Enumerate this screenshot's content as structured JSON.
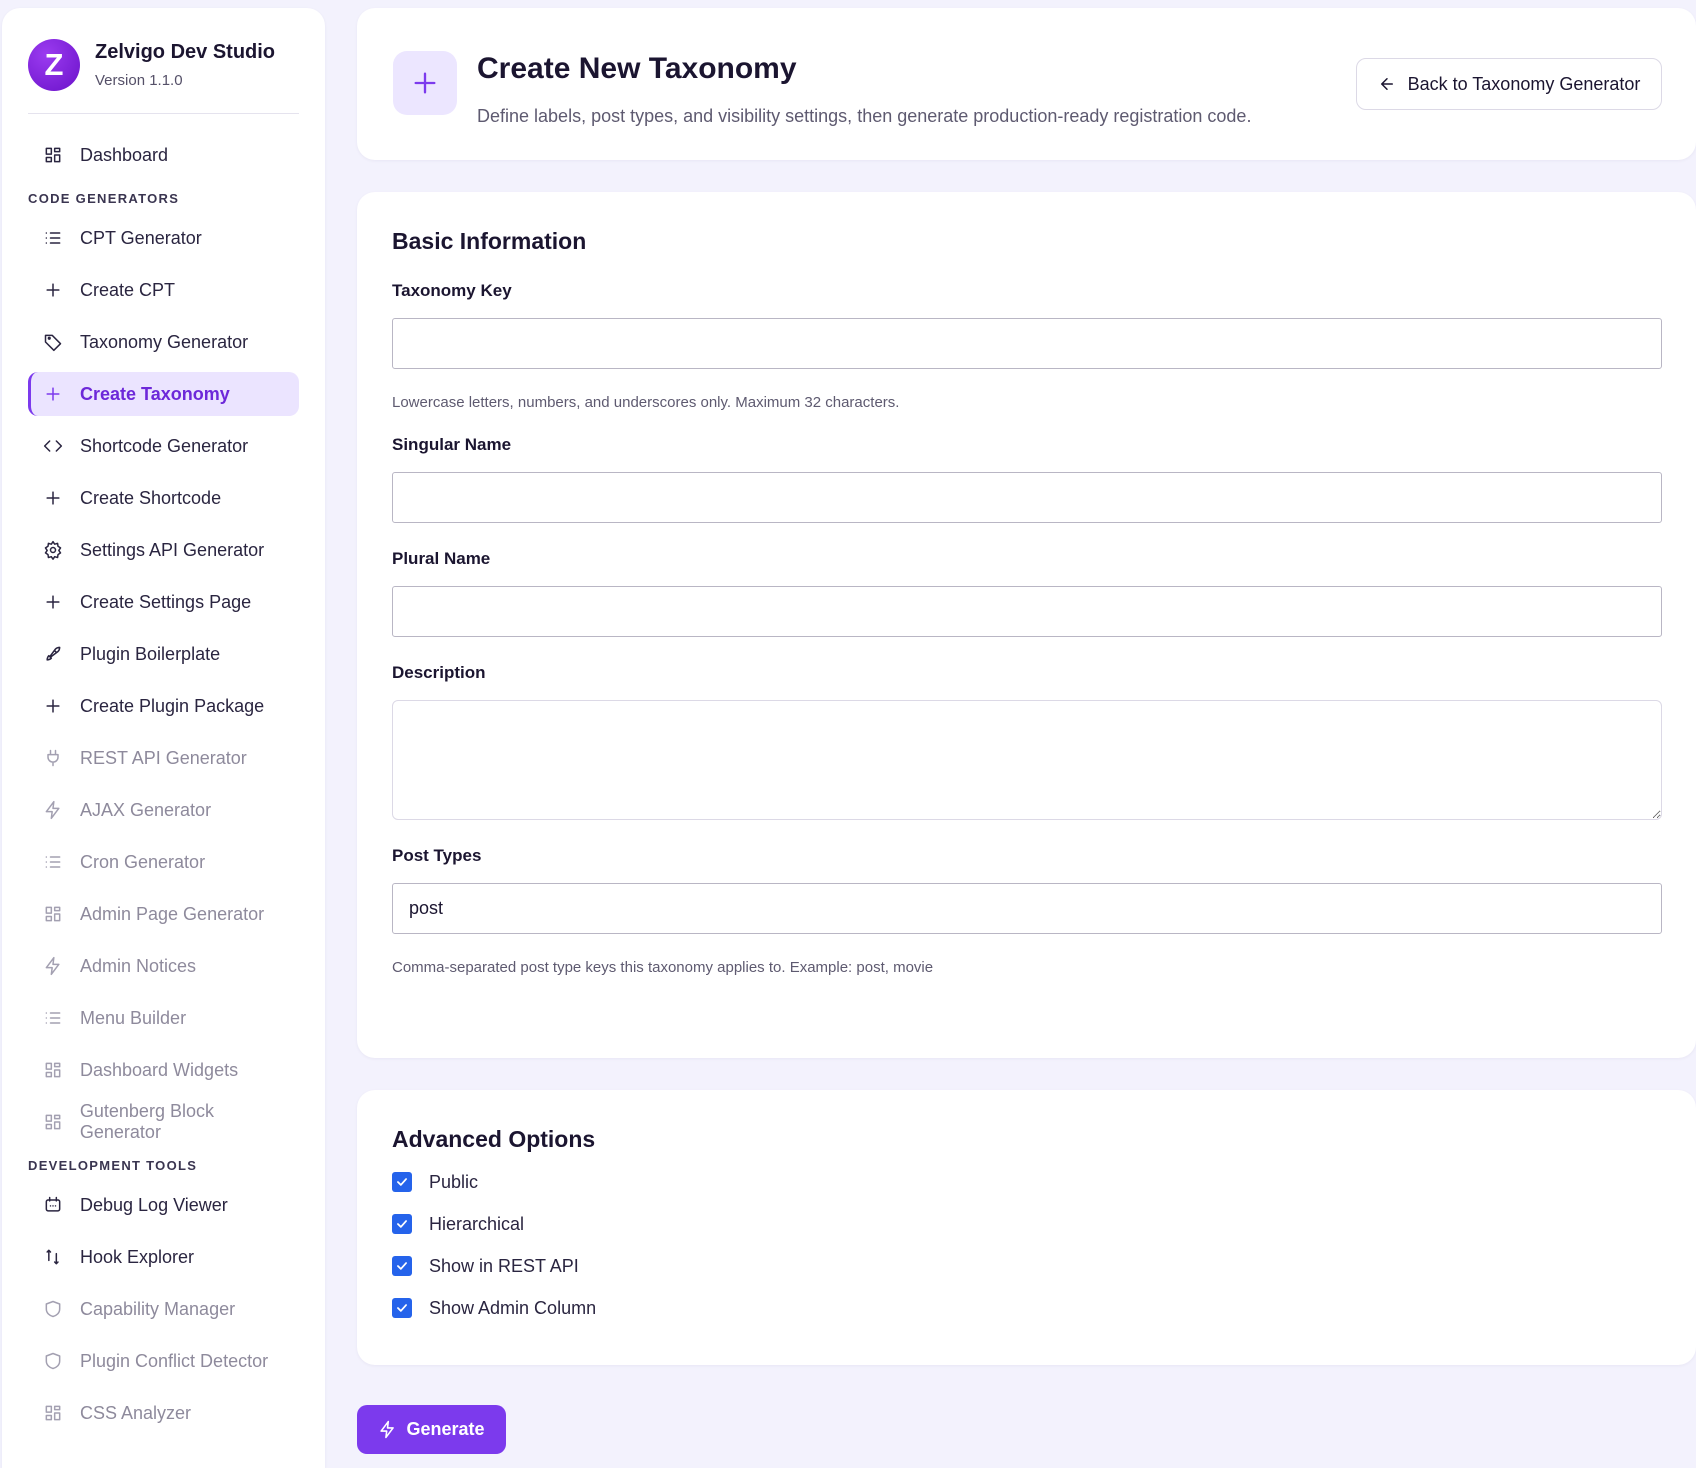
{
  "brand": {
    "logo_letter": "Z",
    "name": "Zelvigo Dev Studio",
    "version": "Version 1.1.0"
  },
  "sidebar": {
    "top_items": [
      {
        "label": "Dashboard",
        "icon": "dashboard-icon"
      }
    ],
    "sections": [
      {
        "title": "CODE GENERATORS",
        "items": [
          {
            "label": "CPT Generator",
            "icon": "list-icon",
            "state": "normal"
          },
          {
            "label": "Create CPT",
            "icon": "plus-icon",
            "state": "normal"
          },
          {
            "label": "Taxonomy Generator",
            "icon": "tag-icon",
            "state": "normal"
          },
          {
            "label": "Create Taxonomy",
            "icon": "plus-icon",
            "state": "active"
          },
          {
            "label": "Shortcode Generator",
            "icon": "code-icon",
            "state": "normal"
          },
          {
            "label": "Create Shortcode",
            "icon": "plus-icon",
            "state": "normal"
          },
          {
            "label": "Settings API Generator",
            "icon": "gear-icon",
            "state": "normal"
          },
          {
            "label": "Create Settings Page",
            "icon": "plus-icon",
            "state": "normal"
          },
          {
            "label": "Plugin Boilerplate",
            "icon": "rocket-icon",
            "state": "normal"
          },
          {
            "label": "Create Plugin Package",
            "icon": "plus-icon",
            "state": "normal"
          },
          {
            "label": "REST API Generator",
            "icon": "plug-icon",
            "state": "disabled"
          },
          {
            "label": "AJAX Generator",
            "icon": "bolt-icon",
            "state": "disabled"
          },
          {
            "label": "Cron Generator",
            "icon": "list-icon",
            "state": "disabled"
          },
          {
            "label": "Admin Page Generator",
            "icon": "dashboard-icon",
            "state": "disabled"
          },
          {
            "label": "Admin Notices",
            "icon": "bolt-icon",
            "state": "disabled"
          },
          {
            "label": "Menu Builder",
            "icon": "list-icon",
            "state": "disabled"
          },
          {
            "label": "Dashboard Widgets",
            "icon": "dashboard-icon",
            "state": "disabled"
          },
          {
            "label": "Gutenberg Block Generator",
            "icon": "dashboard-icon",
            "state": "disabled"
          }
        ]
      },
      {
        "title": "DEVELOPMENT TOOLS",
        "items": [
          {
            "label": "Debug Log Viewer",
            "icon": "bug-icon",
            "state": "normal"
          },
          {
            "label": "Hook Explorer",
            "icon": "hook-icon",
            "state": "normal"
          },
          {
            "label": "Capability Manager",
            "icon": "shield-icon",
            "state": "disabled"
          },
          {
            "label": "Plugin Conflict Detector",
            "icon": "shield-icon",
            "state": "disabled"
          },
          {
            "label": "CSS Analyzer",
            "icon": "dashboard-icon",
            "state": "disabled"
          }
        ]
      }
    ]
  },
  "header": {
    "title": "Create New Taxonomy",
    "subtitle": "Define labels, post types, and visibility settings, then generate production-ready registration code.",
    "back_label": "Back to Taxonomy Generator"
  },
  "basic": {
    "title": "Basic Information",
    "taxonomy_key": {
      "label": "Taxonomy Key",
      "value": "",
      "help": "Lowercase letters, numbers, and underscores only. Maximum 32 characters."
    },
    "singular_name": {
      "label": "Singular Name",
      "value": ""
    },
    "plural_name": {
      "label": "Plural Name",
      "value": ""
    },
    "description": {
      "label": "Description",
      "value": ""
    },
    "post_types": {
      "label": "Post Types",
      "value": "post",
      "help": "Comma-separated post type keys this taxonomy applies to. Example: post, movie"
    }
  },
  "advanced": {
    "title": "Advanced Options",
    "options": [
      {
        "label": "Public",
        "checked": true
      },
      {
        "label": "Hierarchical",
        "checked": true
      },
      {
        "label": "Show in REST API",
        "checked": true
      },
      {
        "label": "Show Admin Column",
        "checked": true
      }
    ]
  },
  "generate_label": "Generate",
  "colors": {
    "accent": "#7c3aed",
    "active_bg": "#ebe4ff",
    "checkbox": "#2563eb",
    "page_bg": "#f3f2fd"
  }
}
